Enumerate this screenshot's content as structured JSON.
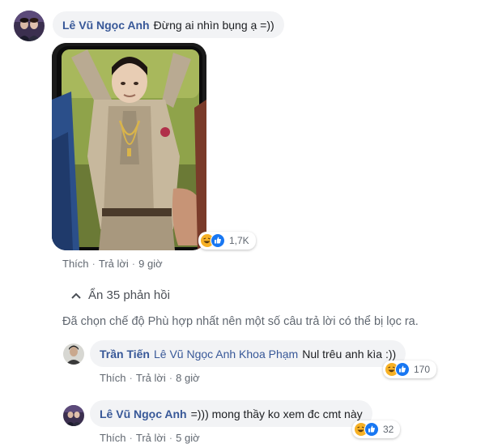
{
  "comment": {
    "author": "Lê Vũ Ngọc Anh",
    "text": "Đừng ai nhìn bụng ạ =))",
    "reactions": {
      "icons": [
        "haha-icon",
        "like-icon"
      ],
      "count": "1,7K"
    },
    "actions": {
      "like": "Thích",
      "reply": "Trả lời",
      "time": "9 giờ"
    }
  },
  "replies_toggle": {
    "label": "Ẩn 35 phản hồi"
  },
  "filter_note": "Đã chọn chế độ Phù hợp nhất nên một số câu trả lời có thể bị lọc ra.",
  "replies": [
    {
      "author": "Trần Tiến",
      "tag": "Lê Vũ Ngọc Anh Khoa Phạm",
      "text": "Nul trêu anh kìa :))",
      "reactions": {
        "icons": [
          "haha-icon",
          "like-icon"
        ],
        "count": "170"
      },
      "actions": {
        "like": "Thích",
        "reply": "Trả lời",
        "time": "8 giờ"
      }
    },
    {
      "author": "Lê Vũ Ngọc Anh",
      "text": "=))) mong thầy ko xem đc cmt này",
      "reactions": {
        "icons": [
          "haha-icon",
          "like-icon"
        ],
        "count": "32"
      },
      "actions": {
        "like": "Thích",
        "reply": "Trả lời",
        "time": "5 giờ"
      }
    }
  ],
  "colors": {
    "author": "#385898",
    "bubble": "#f2f3f5",
    "meta": "#606770",
    "like": "#1877f2",
    "haha": "#f7b125"
  }
}
